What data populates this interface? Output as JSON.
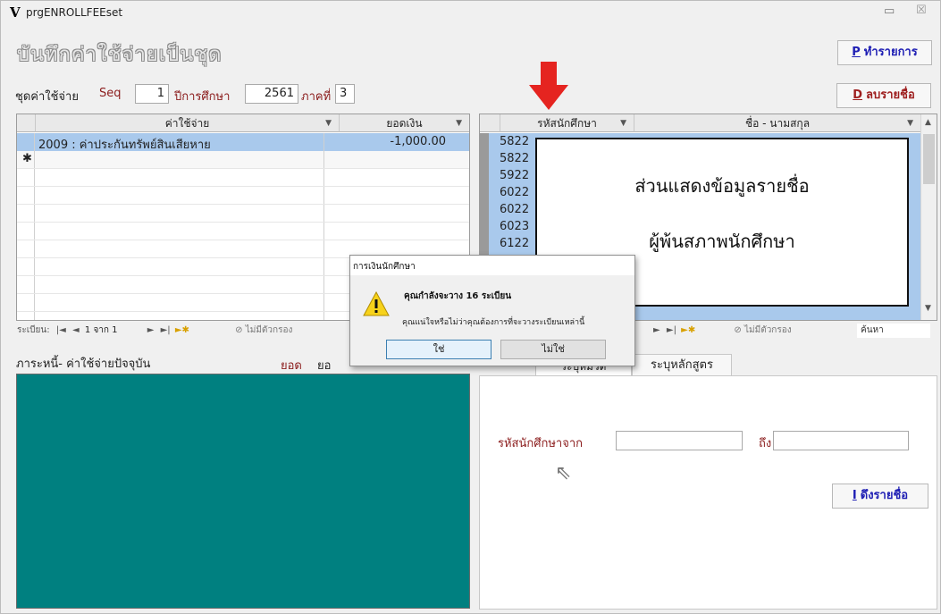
{
  "window": {
    "title": "prgENROLLFEEset",
    "logo": "V",
    "minimize": "▭",
    "close": "☒"
  },
  "header": {
    "title": "บันทึกค่าใช้จ่ายเป็นชุด"
  },
  "toolbar": {
    "process": {
      "key": "P",
      "label": "ทำรายการ"
    },
    "delete": {
      "key": "D",
      "label": "ลบรายชื่อ"
    }
  },
  "params": {
    "set_label": "ชุดค่าใช้จ่าย",
    "seq_label": "Seq",
    "seq_value": "1",
    "year_label": "ปีการศึกษา",
    "year_value": "2561",
    "term_label": "ภาคที่",
    "term_value": "3"
  },
  "fee_grid": {
    "col_item": "ค่าใช้จ่าย",
    "col_amount": "ยอดเงิน",
    "rows": [
      {
        "item": "2009 : ค่าประกันทรัพย์สินเสียหาย",
        "amount": "-1,000.00"
      }
    ],
    "new_row_marker": "✱",
    "nav": {
      "record_label": "ระเบียน:",
      "position": "1 จาก 1",
      "filter": "ไม่มีตัวกรอง"
    }
  },
  "student_grid": {
    "col_id": "รหัสนักศึกษา",
    "col_name": "ชื่อ - นามสกุล",
    "ids": [
      "5822",
      "5822",
      "5922",
      "6022",
      "6022",
      "6023",
      "6122"
    ],
    "nav": {
      "filter": "ไม่มีตัวกรอง",
      "search": "ค้นหา"
    }
  },
  "debt": {
    "title": "ภาระหนี้- ค่าใช้จ่ายปัจจุบัน",
    "total1": "ยอด",
    "total2": "ยอ"
  },
  "right_tabs": {
    "tab1": "ระบุหมวด",
    "tab2": "ระบุหลักสูตร"
  },
  "range": {
    "from_label": "รหัสนักศึกษาจาก",
    "to_label": "ถึง",
    "from_value": "",
    "to_value": ""
  },
  "fetch_button": {
    "key": "I",
    "label": "ดึงรายชื่อ"
  },
  "callout": {
    "line1": "ส่วนแสดงข้อมูลรายชื่อ",
    "line2": "ผู้พ้นสภาพนักศึกษา"
  },
  "dialog": {
    "title": "การเงินนักศึกษา",
    "message": "คุณกำลังจะวาง 16 ระเบียน",
    "question": "คุณแน่ใจหรือไม่ว่าคุณต้องการที่จะวางระเบียนเหล่านี้",
    "yes": "ใช่",
    "no": "ไม่ใช่"
  },
  "colors": {
    "teal": "#008080",
    "arrow": "#e52420",
    "process_blue": "#1f1fb4",
    "delete_red": "#9e1e1e",
    "label_red": "#8b1c1c",
    "selection": "#a9c9ec"
  }
}
